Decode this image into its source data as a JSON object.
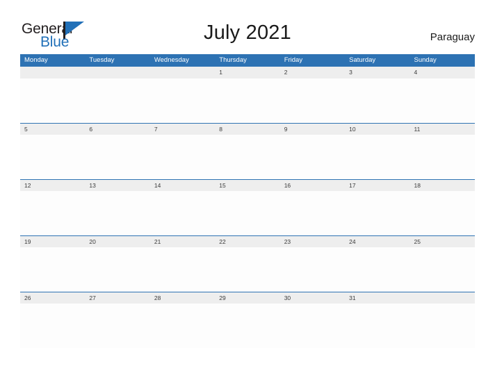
{
  "brand": {
    "name_part1": "General",
    "name_part2": "Blue"
  },
  "header": {
    "title": "July 2021",
    "locale": "Paraguay"
  },
  "calendar": {
    "weekdays": [
      "Monday",
      "Tuesday",
      "Wednesday",
      "Thursday",
      "Friday",
      "Saturday",
      "Sunday"
    ],
    "accent_color": "#2d72b3",
    "band_color": "#eeeeee",
    "weeks": [
      [
        "",
        "",
        "",
        "1",
        "2",
        "3",
        "4"
      ],
      [
        "5",
        "6",
        "7",
        "8",
        "9",
        "10",
        "11"
      ],
      [
        "12",
        "13",
        "14",
        "15",
        "16",
        "17",
        "18"
      ],
      [
        "19",
        "20",
        "21",
        "22",
        "23",
        "24",
        "25"
      ],
      [
        "26",
        "27",
        "28",
        "29",
        "30",
        "31",
        ""
      ]
    ]
  }
}
